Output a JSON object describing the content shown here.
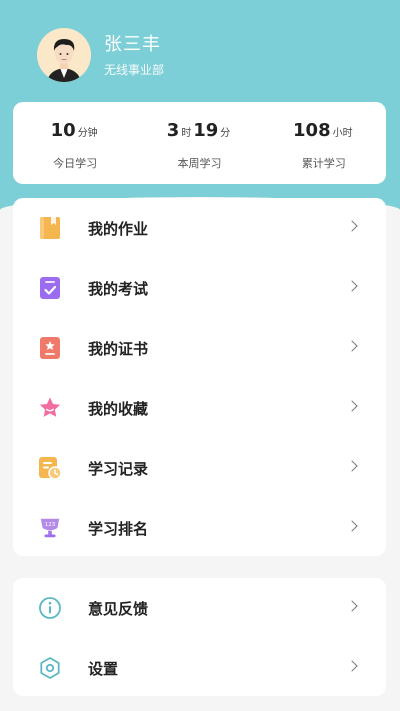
{
  "user": {
    "name": "张三丰",
    "department": "无线事业部"
  },
  "stats": [
    {
      "parts": [
        {
          "v": "10"
        },
        {
          "u": "分钟"
        }
      ],
      "label": "今日学习"
    },
    {
      "parts": [
        {
          "v": "3"
        },
        {
          "u": "时"
        },
        {
          "v": "19"
        },
        {
          "u": "分"
        }
      ],
      "label": "本周学习"
    },
    {
      "parts": [
        {
          "v": "108"
        },
        {
          "u": "小时"
        }
      ],
      "label": "累计学习"
    }
  ],
  "stat_texts": {
    "today_value": "10",
    "today_unit": "分钟",
    "week_hours": "3",
    "week_hours_unit": "时",
    "week_minutes": "19",
    "week_minutes_unit": "分",
    "total_value": "108",
    "total_unit": "小时"
  },
  "menu": {
    "main": [
      {
        "label": "我的作业",
        "icon": "homework-book-icon"
      },
      {
        "label": "我的考试",
        "icon": "exam-check-icon"
      },
      {
        "label": "我的证书",
        "icon": "certificate-icon"
      },
      {
        "label": "我的收藏",
        "icon": "star-icon"
      },
      {
        "label": "学习记录",
        "icon": "learning-record-icon"
      },
      {
        "label": "学习排名",
        "icon": "ranking-trophy-icon"
      }
    ],
    "bottom": [
      {
        "label": "意见反馈",
        "icon": "info-icon"
      },
      {
        "label": "设置",
        "icon": "settings-hexagon-icon"
      }
    ]
  },
  "colors": {
    "header": "#7ccfd6",
    "homework": "#f5b54f",
    "exam": "#9b6cf0",
    "certificate": "#f07a6a",
    "star": "#f06fa0",
    "record": "#f5b54f",
    "ranking": "#b48ae8",
    "outline": "#5bb8c3"
  }
}
